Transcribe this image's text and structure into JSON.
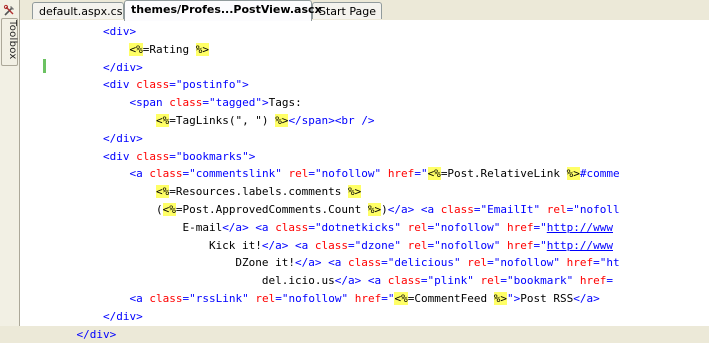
{
  "toolbox": {
    "label": "Toolbox",
    "icon": "toolbox-icon"
  },
  "tabs": [
    {
      "label": "default.aspx.cs",
      "active": false
    },
    {
      "label": "themes/Profes...PostView.ascx",
      "active": true
    },
    {
      "label": "Start Page",
      "active": false
    }
  ],
  "code_lines": [
    "        <div>",
    "            <%=Rating %>",
    "        </div>",
    "        <div class=\"postinfo\">",
    "            <span class=\"tagged\">Tags:",
    "                <%=TagLinks(\", \") %></span><br />",
    "        </div>",
    "        <div class=\"bookmarks\">",
    "            <a class=\"commentslink\" rel=\"nofollow\" href=\"<%=Post.RelativeLink %>#comme",
    "                <%=Resources.labels.comments %>",
    "                (<%=Post.ApprovedComments.Count %>)</a> <a class=\"EmailIt\" rel=\"nofoll",
    "                    E-mail</a> <a class=\"dotnetkicks\" rel=\"nofollow\" href=\"http://www",
    "                        Kick it!</a> <a class=\"dzone\" rel=\"nofollow\" href=\"http://www",
    "                            DZone it!</a> <a class=\"delicious\" rel=\"nofollow\" href=\"ht",
    "                                del.icio.us</a> <a class=\"plink\" rel=\"bookmark\" href=",
    "            <a class=\"rssLink\" rel=\"nofollow\" href=\"<%=CommentFeed %>\">Post RSS</a>",
    "        </div>",
    "    </div>"
  ],
  "colors": {
    "tag": "#0000ff",
    "attribute": "#ff0000",
    "text": "#000000",
    "server_block": "#ffff66",
    "change_marker": "#6cc262"
  }
}
